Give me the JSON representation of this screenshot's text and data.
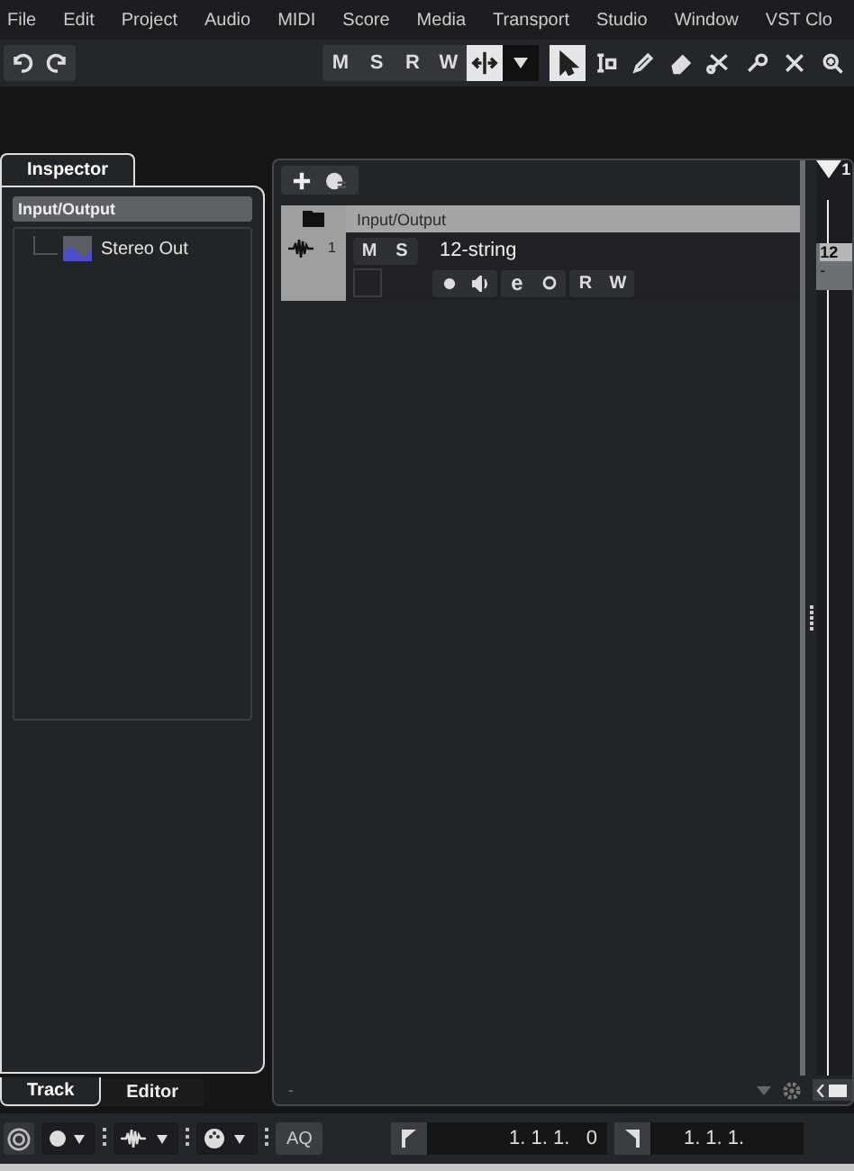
{
  "menu": [
    "File",
    "Edit",
    "Project",
    "Audio",
    "MIDI",
    "Score",
    "Media",
    "Transport",
    "Studio",
    "Window",
    "VST Clo"
  ],
  "toolbar": {
    "state_buttons": [
      "M",
      "S",
      "R",
      "W"
    ],
    "autoscroll_on": true,
    "tools": [
      {
        "kind": "arrow",
        "selected": true
      },
      {
        "kind": "range",
        "selected": false
      },
      {
        "kind": "pencil",
        "selected": false
      },
      {
        "kind": "eraser",
        "selected": false
      },
      {
        "kind": "scissors",
        "selected": false
      },
      {
        "kind": "glue",
        "selected": false
      },
      {
        "kind": "mute",
        "selected": false
      },
      {
        "kind": "zoom",
        "selected": false
      }
    ]
  },
  "inspector": {
    "tab": "Inspector",
    "section": "Input/Output",
    "tree": [
      {
        "label": "Stereo Out"
      }
    ],
    "bottom_tabs": [
      {
        "label": "Track",
        "selected": true
      },
      {
        "label": "Editor",
        "selected": false
      }
    ]
  },
  "project": {
    "folder_track": "Input/Output",
    "tracks": [
      {
        "number": "1",
        "name": "12-string",
        "buttons_top": [
          "M",
          "S"
        ],
        "buttons_bottom": [
          "R",
          "W"
        ],
        "edit_label": "e"
      }
    ],
    "ruler_marker": "1",
    "event_label": "12",
    "event_sub": "-",
    "footer_text": "-"
  },
  "transport": {
    "aq": "AQ",
    "left_locator": "1. 1. 1.   0",
    "right_locator": "1. 1. 1."
  }
}
